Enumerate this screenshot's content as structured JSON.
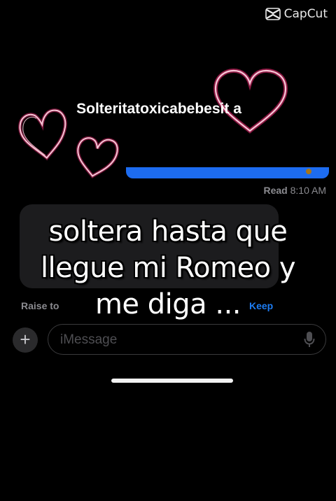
{
  "watermark": {
    "brand": "CapCut"
  },
  "caption_top": "Solteritatoxicabebesit a",
  "chat": {
    "read_status": "Read",
    "read_time": "8:10 AM",
    "raise_to_label": "Raise to",
    "keep_label": "Keep",
    "input_placeholder": "iMessage",
    "plus_symbol": "+"
  },
  "overlay_text": {
    "line1": "soltera hasta que",
    "line2": "llegue mi Romeo y",
    "line3": "me diga ..."
  },
  "colors": {
    "background": "#000000",
    "imessage_blue": "#1d6cf0",
    "heart_pink": "#f7c6d6",
    "heart_glow": "#ff2d7a",
    "keep_blue": "#1d7cf2"
  },
  "icons": [
    "capcut-logo-icon",
    "heart-icon",
    "plus-icon",
    "microphone-icon"
  ]
}
